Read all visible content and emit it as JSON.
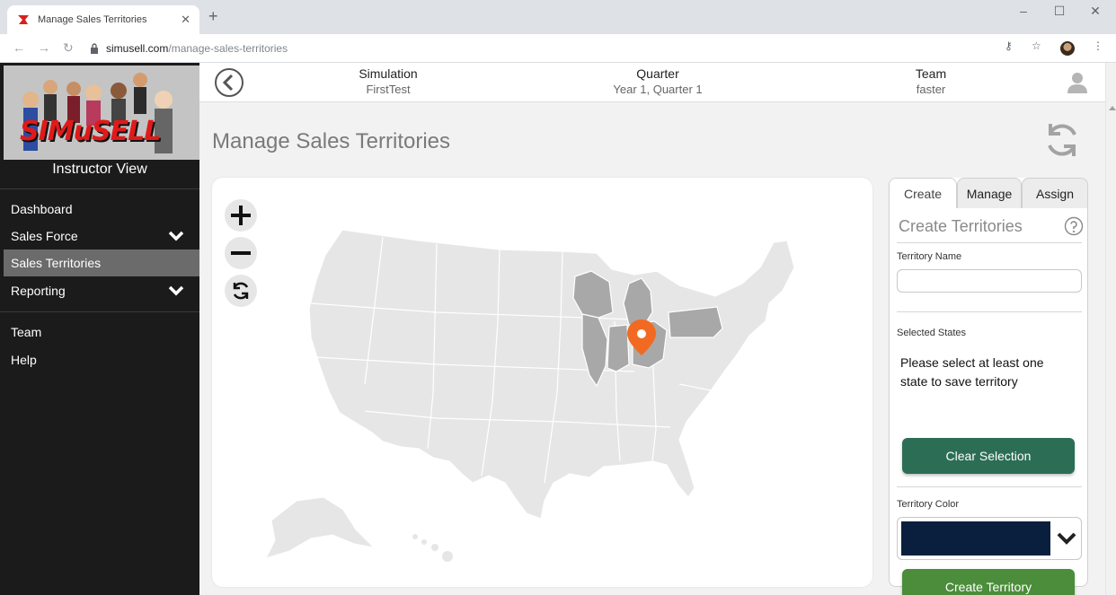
{
  "browser": {
    "tab_title": "Manage Sales Territories",
    "url_host": "simusell.com",
    "url_path": "/manage-sales-territories"
  },
  "sidebar": {
    "logo_text": "SIMuSELL",
    "view_label": "Instructor View",
    "items": [
      {
        "label": "Dashboard"
      },
      {
        "label": "Sales Force"
      },
      {
        "label": "Sales Territories"
      },
      {
        "label": "Reporting"
      },
      {
        "label": "Team"
      },
      {
        "label": "Help"
      }
    ]
  },
  "header": {
    "simulation_label": "Simulation",
    "simulation_value": "FirstTest",
    "quarter_label": "Quarter",
    "quarter_value": "Year 1, Quarter 1",
    "team_label": "Team",
    "team_value": "faster"
  },
  "page": {
    "title": "Manage Sales Territories"
  },
  "map": {
    "selected_states": [
      "Wisconsin",
      "Illinois",
      "Michigan",
      "Indiana",
      "Ohio",
      "Pennsylvania"
    ],
    "base_color": "#e6e6e6",
    "selected_color": "#a8a8a8",
    "marker_color": "#f26a21"
  },
  "panel": {
    "tabs": [
      {
        "label": "Create"
      },
      {
        "label": "Manage"
      },
      {
        "label": "Assign"
      }
    ],
    "heading": "Create Territories",
    "territory_name_label": "Territory Name",
    "territory_name_value": "",
    "selected_states_label": "Selected States",
    "notice": "Please select at least one state to save territory",
    "clear_button": "Clear Selection",
    "color_label": "Territory Color",
    "color_value": "#0a1f3d",
    "create_button": "Create Territory"
  }
}
